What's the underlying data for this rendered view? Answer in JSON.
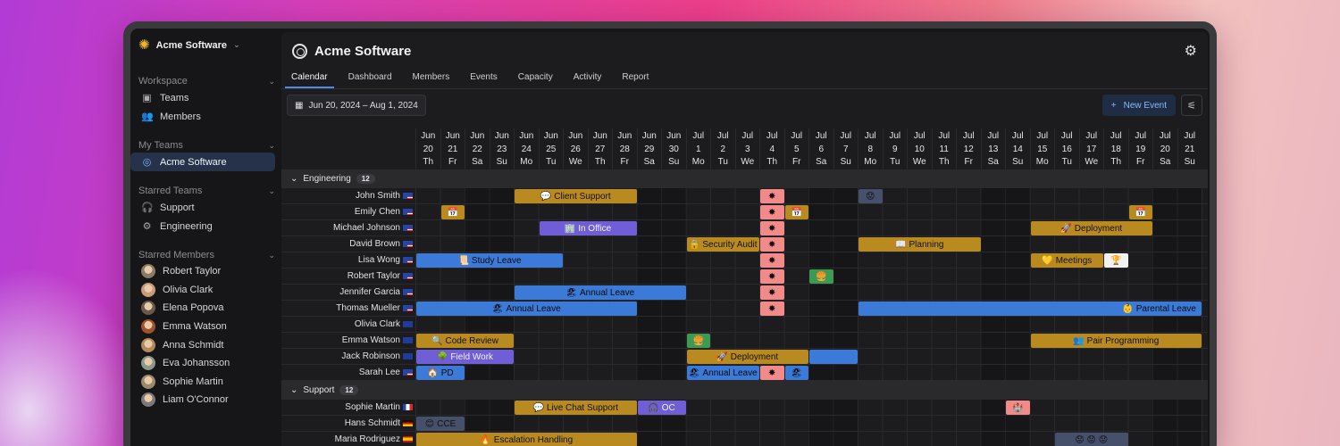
{
  "app": {
    "workspace_name": "Acme Software",
    "title": "Acme Software"
  },
  "sidebar": {
    "workspace_label": "Workspace",
    "workspace_items": [
      {
        "label": "Teams",
        "icon": "grid-icon"
      },
      {
        "label": "Members",
        "icon": "users-icon"
      }
    ],
    "my_teams_label": "My Teams",
    "my_teams": [
      {
        "label": "Acme Software",
        "icon": "aperture-icon",
        "active": true
      }
    ],
    "starred_teams_label": "Starred Teams",
    "starred_teams": [
      {
        "label": "Support",
        "icon": "headphones-icon"
      },
      {
        "label": "Engineering",
        "icon": "gear-icon"
      }
    ],
    "starred_members_label": "Starred Members",
    "starred_members": [
      {
        "label": "Robert Taylor",
        "color": "#8a7a66"
      },
      {
        "label": "Olivia Clark",
        "color": "#c89b7b"
      },
      {
        "label": "Elena Popova",
        "color": "#6b5a4a"
      },
      {
        "label": "Emma Watson",
        "color": "#a0522d"
      },
      {
        "label": "Anna Schmidt",
        "color": "#b08a5a"
      },
      {
        "label": "Eva Johansson",
        "color": "#8a9a8a"
      },
      {
        "label": "Sophie Martin",
        "color": "#9a8a6a"
      },
      {
        "label": "Liam O'Connor",
        "color": "#7a7a7a"
      }
    ]
  },
  "tabs": [
    "Calendar",
    "Dashboard",
    "Members",
    "Events",
    "Capacity",
    "Activity",
    "Report"
  ],
  "toolbar": {
    "date_range": "Jun 20, 2024 – Aug 1, 2024",
    "new_event": "New Event"
  },
  "dates": [
    {
      "m": "Jun",
      "d": "20",
      "w": "Th"
    },
    {
      "m": "Jun",
      "d": "21",
      "w": "Fr"
    },
    {
      "m": "Jun",
      "d": "22",
      "w": "Sa"
    },
    {
      "m": "Jun",
      "d": "23",
      "w": "Su"
    },
    {
      "m": "Jun",
      "d": "24",
      "w": "Mo"
    },
    {
      "m": "Jun",
      "d": "25",
      "w": "Tu"
    },
    {
      "m": "Jun",
      "d": "26",
      "w": "We"
    },
    {
      "m": "Jun",
      "d": "27",
      "w": "Th"
    },
    {
      "m": "Jun",
      "d": "28",
      "w": "Fr"
    },
    {
      "m": "Jun",
      "d": "29",
      "w": "Sa"
    },
    {
      "m": "Jun",
      "d": "30",
      "w": "Su"
    },
    {
      "m": "Jul",
      "d": "1",
      "w": "Mo"
    },
    {
      "m": "Jul",
      "d": "2",
      "w": "Tu"
    },
    {
      "m": "Jul",
      "d": "3",
      "w": "We"
    },
    {
      "m": "Jul",
      "d": "4",
      "w": "Th"
    },
    {
      "m": "Jul",
      "d": "5",
      "w": "Fr"
    },
    {
      "m": "Jul",
      "d": "6",
      "w": "Sa"
    },
    {
      "m": "Jul",
      "d": "7",
      "w": "Su"
    },
    {
      "m": "Jul",
      "d": "8",
      "w": "Mo"
    },
    {
      "m": "Jul",
      "d": "9",
      "w": "Tu"
    },
    {
      "m": "Jul",
      "d": "10",
      "w": "We"
    },
    {
      "m": "Jul",
      "d": "11",
      "w": "Th"
    },
    {
      "m": "Jul",
      "d": "12",
      "w": "Fr"
    },
    {
      "m": "Jul",
      "d": "13",
      "w": "Sa"
    },
    {
      "m": "Jul",
      "d": "14",
      "w": "Su"
    },
    {
      "m": "Jul",
      "d": "15",
      "w": "Mo"
    },
    {
      "m": "Jul",
      "d": "16",
      "w": "Tu"
    },
    {
      "m": "Jul",
      "d": "17",
      "w": "We"
    },
    {
      "m": "Jul",
      "d": "18",
      "w": "Th"
    },
    {
      "m": "Jul",
      "d": "19",
      "w": "Fr"
    },
    {
      "m": "Jul",
      "d": "20",
      "w": "Sa"
    },
    {
      "m": "Jul",
      "d": "21",
      "w": "Su"
    }
  ],
  "groups": [
    {
      "name": "Engineering",
      "count": "12",
      "members": [
        {
          "name": "John Smith",
          "flag": "us",
          "events": [
            {
              "start": 4,
              "span": 5,
              "label": "Client Support",
              "icon": "💬",
              "color": "gold"
            },
            {
              "start": 14,
              "span": 1,
              "label": "",
              "icon": "✸",
              "color": "pink"
            },
            {
              "start": 18,
              "span": 1,
              "label": "",
              "icon": "😟",
              "color": "slate"
            }
          ]
        },
        {
          "name": "Emily Chen",
          "flag": "us",
          "events": [
            {
              "start": 1,
              "span": 1,
              "label": "",
              "icon": "📅",
              "color": "gold"
            },
            {
              "start": 14,
              "span": 1,
              "label": "",
              "icon": "✸",
              "color": "pink"
            },
            {
              "start": 15,
              "span": 1,
              "label": "",
              "icon": "📅",
              "color": "gold"
            },
            {
              "start": 29,
              "span": 1,
              "label": "",
              "icon": "📅",
              "color": "gold"
            }
          ]
        },
        {
          "name": "Michael Johnson",
          "flag": "us",
          "events": [
            {
              "start": 5,
              "span": 4,
              "label": "In Office",
              "icon": "🏢",
              "color": "purple"
            },
            {
              "start": 14,
              "span": 1,
              "label": "",
              "icon": "✸",
              "color": "pink"
            },
            {
              "start": 25,
              "span": 5,
              "label": "Deployment",
              "icon": "🚀",
              "color": "gold"
            }
          ]
        },
        {
          "name": "David Brown",
          "flag": "us",
          "events": [
            {
              "start": 11,
              "span": 3,
              "label": "Security Audit",
              "icon": "🔒",
              "color": "gold"
            },
            {
              "start": 14,
              "span": 1,
              "label": "",
              "icon": "✸",
              "color": "pink"
            },
            {
              "start": 18,
              "span": 5,
              "label": "Planning",
              "icon": "📖",
              "color": "gold"
            }
          ]
        },
        {
          "name": "Lisa Wong",
          "flag": "us",
          "events": [
            {
              "start": 0,
              "span": 6,
              "label": "Study Leave",
              "icon": "📜",
              "color": "blue"
            },
            {
              "start": 14,
              "span": 1,
              "label": "",
              "icon": "✸",
              "color": "pink"
            },
            {
              "start": 25,
              "span": 3,
              "label": "Meetings",
              "icon": "💛",
              "color": "gold"
            },
            {
              "start": 28,
              "span": 1,
              "label": "",
              "icon": "🏆",
              "color": "white"
            }
          ]
        },
        {
          "name": "Robert Taylor",
          "flag": "us",
          "events": [
            {
              "start": 14,
              "span": 1,
              "label": "",
              "icon": "✸",
              "color": "pink"
            },
            {
              "start": 16,
              "span": 1,
              "label": "",
              "icon": "🍔",
              "color": "green"
            }
          ]
        },
        {
          "name": "Jennifer Garcia",
          "flag": "us",
          "events": [
            {
              "start": 4,
              "span": 7,
              "label": "Annual Leave",
              "icon": "🏖",
              "color": "blue"
            },
            {
              "start": 14,
              "span": 1,
              "label": "",
              "icon": "✸",
              "color": "pink"
            }
          ]
        },
        {
          "name": "Thomas Mueller",
          "flag": "us",
          "events": [
            {
              "start": 0,
              "span": 9,
              "label": "Annual Leave",
              "icon": "🏖",
              "color": "blue"
            },
            {
              "start": 14,
              "span": 1,
              "label": "",
              "icon": "✸",
              "color": "pink"
            },
            {
              "start": 18,
              "span": 14,
              "label": "Parental Leave",
              "icon": "👶",
              "color": "blue",
              "align": "right"
            }
          ]
        },
        {
          "name": "Olivia Clark",
          "flag": "au",
          "events": []
        },
        {
          "name": "Emma Watson",
          "flag": "au",
          "events": [
            {
              "start": 0,
              "span": 4,
              "label": "Code Review",
              "icon": "🔍",
              "color": "gold"
            },
            {
              "start": 11,
              "span": 1,
              "label": "",
              "icon": "🍔",
              "color": "green"
            },
            {
              "start": 25,
              "span": 7,
              "label": "Pair Programming",
              "icon": "👥",
              "color": "gold"
            }
          ]
        },
        {
          "name": "Jack Robinson",
          "flag": "au",
          "events": [
            {
              "start": 0,
              "span": 4,
              "label": "Field Work",
              "icon": "🌳",
              "color": "purple"
            },
            {
              "start": 11,
              "span": 5,
              "label": "Deployment",
              "icon": "🚀",
              "color": "gold"
            },
            {
              "start": 16,
              "span": 2,
              "label": "",
              "icon": "",
              "color": "blue"
            }
          ]
        },
        {
          "name": "Sarah Lee",
          "flag": "us",
          "events": [
            {
              "start": 0,
              "span": 2,
              "label": "PD",
              "icon": "🏠",
              "color": "blue"
            },
            {
              "start": 11,
              "span": 3,
              "label": "Annual Leave",
              "icon": "🏖",
              "color": "blue"
            },
            {
              "start": 14,
              "span": 1,
              "label": "",
              "icon": "✸",
              "color": "pink"
            },
            {
              "start": 15,
              "span": 1,
              "label": "",
              "icon": "🏖",
              "color": "blue"
            }
          ]
        }
      ]
    },
    {
      "name": "Support",
      "count": "12",
      "members": [
        {
          "name": "Sophie Martin",
          "flag": "fr",
          "events": [
            {
              "start": 4,
              "span": 5,
              "label": "Live Chat Support",
              "icon": "💬",
              "color": "gold"
            },
            {
              "start": 9,
              "span": 2,
              "label": "OC",
              "icon": "🎧",
              "color": "purple"
            },
            {
              "start": 24,
              "span": 1,
              "label": "",
              "icon": "🏰",
              "color": "pink"
            }
          ]
        },
        {
          "name": "Hans Schmidt",
          "flag": "de",
          "events": [
            {
              "start": 0,
              "span": 2,
              "label": "CCE",
              "icon": "😊",
              "color": "slate"
            }
          ]
        },
        {
          "name": "Maria Rodriguez",
          "flag": "es",
          "events": [
            {
              "start": 0,
              "span": 9,
              "label": "Escalation Handling",
              "icon": "🔥",
              "color": "gold"
            },
            {
              "start": 26,
              "span": 3,
              "label": "",
              "icon": "😟 😟 😟",
              "color": "slate"
            }
          ]
        }
      ]
    }
  ]
}
